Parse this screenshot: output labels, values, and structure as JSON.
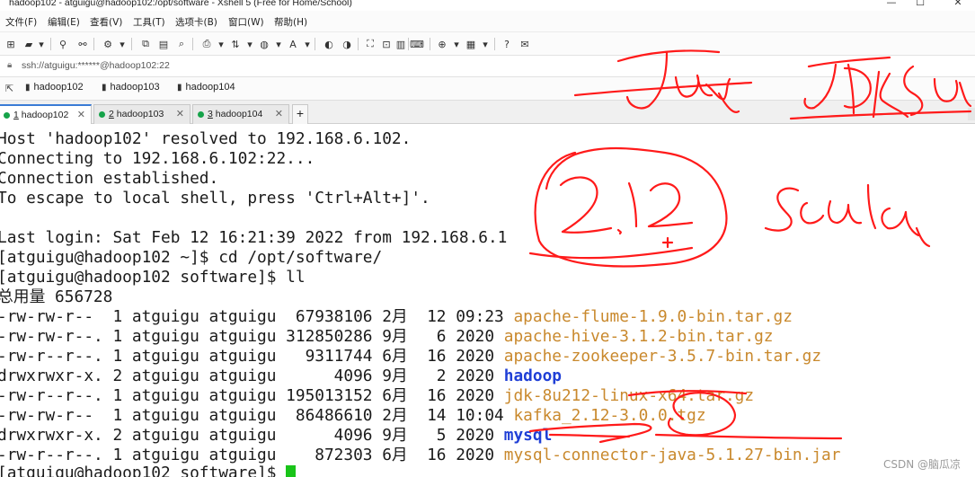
{
  "window": {
    "title": "hadoop102 - atguigu@hadoop102:/opt/software - Xshell 5 (Free for Home/School)",
    "controls": [
      "—",
      "☐",
      "✕"
    ]
  },
  "menu": [
    "文件(F)",
    "编辑(E)",
    "查看(V)",
    "工具(T)",
    "选项卡(B)",
    "窗口(W)",
    "帮助(H)"
  ],
  "address": {
    "url": "ssh://atguigu:******@hadoop102:22"
  },
  "links": [
    "hadoop102",
    "hadoop103",
    "hadoop104"
  ],
  "tabs": [
    {
      "num": "1",
      "label": "hadoop102",
      "active": true
    },
    {
      "num": "2",
      "label": "hadoop103",
      "active": false
    },
    {
      "num": "3",
      "label": "hadoop104",
      "active": false
    }
  ],
  "terminal": {
    "lines": [
      "Host 'hadoop102' resolved to 192.168.6.102.",
      "Connecting to 192.168.6.102:22...",
      "Connection established.",
      "To escape to local shell, press 'Ctrl+Alt+]'.",
      "",
      "Last login: Sat Feb 12 16:21:39 2022 from 192.168.6.1",
      "[atguigu@hadoop102 ~]$ cd /opt/software/",
      "[atguigu@hadoop102 software]$ ll",
      "总用量 656728"
    ],
    "files": [
      {
        "meta": "-rw-rw-r--  1 atguigu atguigu  67938106 2月  12 09:23 ",
        "name": "apache-flume-1.9.0-bin.tar.gz",
        "kind": "archive"
      },
      {
        "meta": "-rw-rw-r--. 1 atguigu atguigu 312850286 9月   6 2020 ",
        "name": "apache-hive-3.1.2-bin.tar.gz",
        "kind": "archive"
      },
      {
        "meta": "-rw-r--r--. 1 atguigu atguigu   9311744 6月  16 2020 ",
        "name": "apache-zookeeper-3.5.7-bin.tar.gz",
        "kind": "archive"
      },
      {
        "meta": "drwxrwxr-x. 2 atguigu atguigu      4096 9月   2 2020 ",
        "name": "hadoop",
        "kind": "dir"
      },
      {
        "meta": "-rw-r--r--. 1 atguigu atguigu 195013152 6月  16 2020 ",
        "name": "jdk-8u212-linux-x64.tar.gz",
        "kind": "archive"
      },
      {
        "meta": "-rw-rw-r--  1 atguigu atguigu  86486610 2月  14 10:04 ",
        "name": "kafka_2.12-3.0.0.tgz",
        "kind": "archive"
      },
      {
        "meta": "drwxrwxr-x. 2 atguigu atguigu      4096 9月   5 2020 ",
        "name": "mysql",
        "kind": "dir"
      },
      {
        "meta": "-rw-r--r--. 1 atguigu atguigu    872303 6月  16 2020 ",
        "name": "mysql-connector-java-5.1.27-bin.jar",
        "kind": "archive"
      }
    ],
    "prompt": "[atguigu@hadoop102 software]$ "
  },
  "colors": {
    "dir": "#1f3fd6",
    "archive": "#c9892d",
    "cursor": "#19c419",
    "ink": "#ff1a1a",
    "tab_accent": "#3a7bd5"
  },
  "watermark": "CSDN @脑瓜凉"
}
